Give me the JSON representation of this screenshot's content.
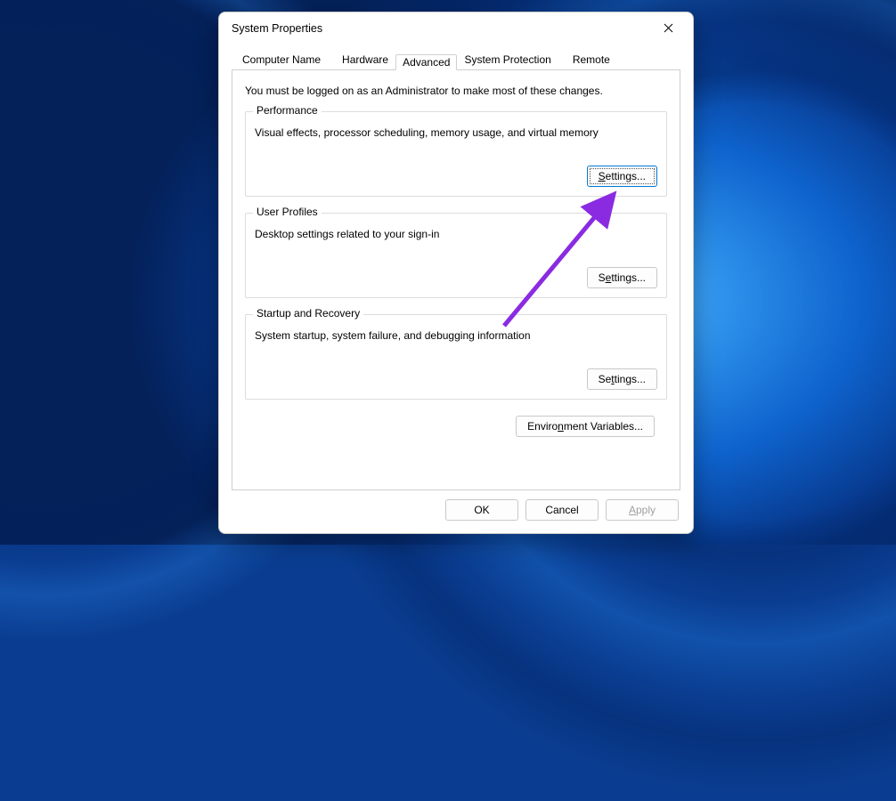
{
  "dialog": {
    "title": "System Properties",
    "tabs": [
      {
        "label": "Computer Name"
      },
      {
        "label": "Hardware"
      },
      {
        "label": "Advanced"
      },
      {
        "label": "System Protection"
      },
      {
        "label": "Remote"
      }
    ],
    "intro": "You must be logged on as an Administrator to make most of these changes.",
    "groups": {
      "performance": {
        "label": "Performance",
        "desc": "Visual effects, processor scheduling, memory usage, and virtual memory",
        "button": "Settings..."
      },
      "userProfiles": {
        "label": "User Profiles",
        "desc": "Desktop settings related to your sign-in",
        "button": "Settings..."
      },
      "startupRecovery": {
        "label": "Startup and Recovery",
        "desc": "System startup, system failure, and debugging information",
        "button": "Settings..."
      }
    },
    "envButton": "Environment Variables...",
    "buttons": {
      "ok": "OK",
      "cancel": "Cancel",
      "apply": "Apply"
    }
  }
}
